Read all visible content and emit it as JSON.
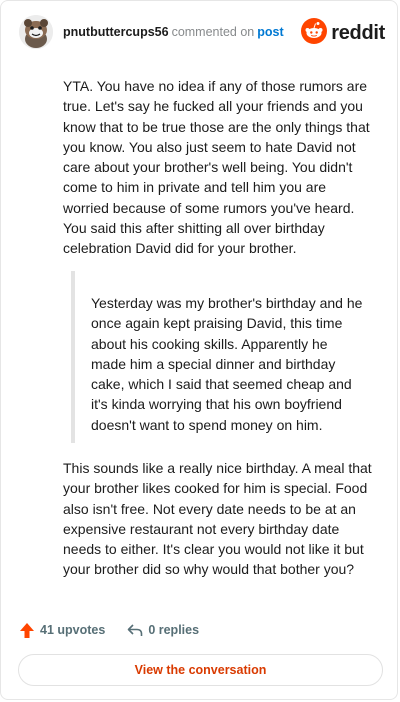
{
  "header": {
    "username": "pnutbuttercups56",
    "action": "commented on",
    "target": "post",
    "brand": "reddit",
    "avatar_icon": "snoo-avatar-icon",
    "brand_icon": "reddit-logo-icon"
  },
  "comment": {
    "paragraph_1": "YTA. You have no idea if any of those rumors are true. Let's say he fucked all your friends and you know that to be true those are the only things that you know. You also just seem to hate David not care about your brother's well being. You didn't come to him in private and tell him you are worried because of some rumors you've heard. You said this after shitting all over birthday celebration David did for your brother.",
    "quote": "Yesterday was my brother's birthday and he once again kept praising David, this time about his cooking skills. Apparently he made him a special dinner and birthday cake, which I said that seemed cheap and it's kinda worrying that his own boyfriend doesn't want to spend money on him.",
    "paragraph_2": "This sounds like a really nice birthday. A meal that your brother likes cooked for him is special. Food also isn't free. Not every date needs to be at an expensive restaurant not every birthday date needs to either. It's clear you would not like it but your brother did so why would that bother you?"
  },
  "footer": {
    "upvotes": "41 upvotes",
    "replies": "0 replies",
    "upvote_icon": "upvote-arrow-icon",
    "reply_icon": "reply-arrow-icon",
    "view_conversation": "View the conversation"
  },
  "colors": {
    "accent": "#ff4500",
    "link": "#0079d3",
    "cta_text": "#d93a00",
    "muted": "#878a8c"
  }
}
